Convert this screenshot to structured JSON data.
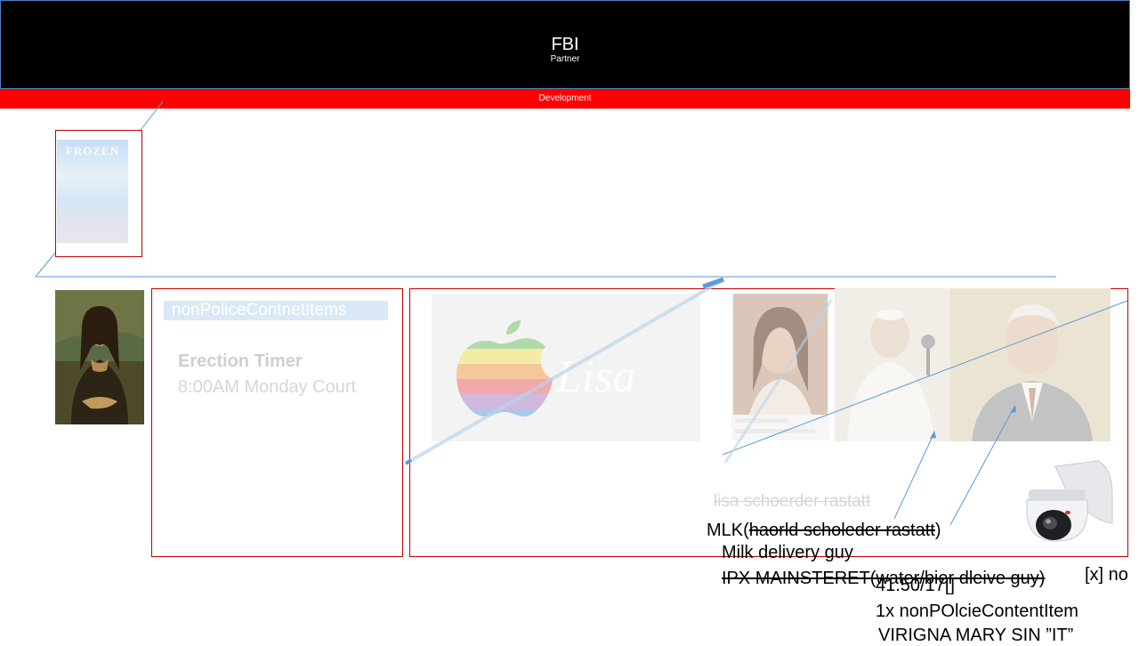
{
  "header": {
    "title": "FBI",
    "subtitle": "Partner",
    "environment": "Development"
  },
  "frozen_poster": {
    "title": "FROZEN"
  },
  "left_panel": {
    "tag": "nonPoliceContnetItems",
    "timer_title": "Erection Timer",
    "timer_detail": "8:00AM Monday Court"
  },
  "right_panel": {
    "lisa_caption": "lisa schoerder rastatt",
    "mlk_prefix": "MLK(",
    "mlk_struck": "haorld scholeder rastatt",
    "mlk_suffix": ")",
    "milk_caption": "Milk delivery guy",
    "ipx_caption": "IPX MAINSTERET(water/bier dleive guy)",
    "time_caption": "41.50/17[]",
    "item_caption": "1x nonPOlcieContentItem",
    "virgin_caption": "VIRIGNA MARY SIN ”IT”",
    "no_caption": "[x] no"
  },
  "colors": {
    "header_bg": "#000000",
    "env_bar": "#ff0000",
    "frame_red": "#c00000",
    "line_blue": "#5b9bd5"
  },
  "icons": [
    "camera-icon",
    "apple-logo-icon"
  ]
}
